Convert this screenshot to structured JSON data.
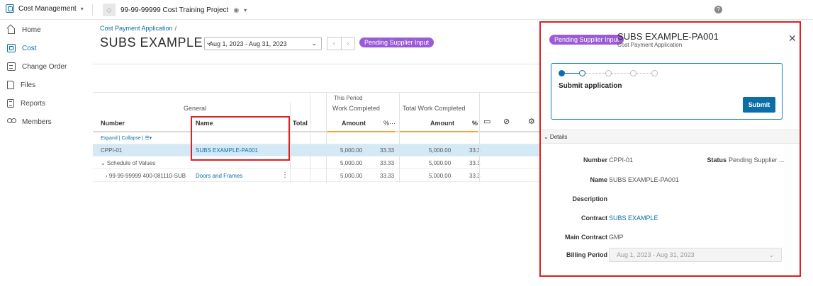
{
  "topbar": {
    "app_name": "Cost Management",
    "project_name": "99-99-99999 Cost Training Project",
    "help_glyph": "?"
  },
  "sidebar": {
    "items": [
      {
        "label": "Home",
        "icon": "home-icon"
      },
      {
        "label": "Cost",
        "icon": "cost-icon",
        "active": true
      },
      {
        "label": "Change Order",
        "icon": "change-order-icon"
      },
      {
        "label": "Files",
        "icon": "file-icon"
      },
      {
        "label": "Reports",
        "icon": "report-icon"
      },
      {
        "label": "Members",
        "icon": "members-icon"
      }
    ]
  },
  "main": {
    "breadcrumb": "Cost Payment Application",
    "breadcrumb_sep": "/",
    "title": "SUBS EXAMPLE",
    "period": "Aug 1, 2023 - Aug 31, 2023",
    "status": "Pending Supplier Input"
  },
  "grid": {
    "group_general": "General",
    "group_this_period": "This Period",
    "sub_work_completed": "Work Completed",
    "sub_total_work_completed": "Total Work Completed",
    "col_number": "Number",
    "col_name": "Name",
    "col_total": "Total",
    "col_amount": "Amount",
    "col_pct": "%",
    "col_pct_more": "%···",
    "toolbar": "Expand | Collapse | ☰▾",
    "rows": [
      {
        "number": "CPPI-01",
        "name": "SUBS EXAMPLE-PA001",
        "amount": "5,000.00",
        "pct": "33.33",
        "total_amount": "5,000.00",
        "total_pct": "33.3"
      },
      {
        "number": "⌄ Schedule of Values",
        "name": "",
        "amount": "5,000.00",
        "pct": "33.33",
        "total_amount": "5,000.00",
        "total_pct": "33.3"
      },
      {
        "number": "› 99-99-99999 400-081110-SUB",
        "name": "Doors and Frames",
        "amount": "5,000.00",
        "pct": "33.33",
        "total_amount": "5,000.00",
        "total_pct": "33.3"
      }
    ]
  },
  "panel": {
    "status": "Pending Supplier Input",
    "title": "SUBS EXAMPLE-PA001",
    "subtitle": "Cost Payment Application",
    "step_label": "Submit application",
    "submit_label": "Submit",
    "details_label": "⌄ Details",
    "fields": {
      "number_label": "Number",
      "number_value": "CPPI-01",
      "status_label": "Status",
      "status_value": "Pending Supplier ...",
      "name_label": "Name",
      "name_value": "SUBS EXAMPLE-PA001",
      "description_label": "Description",
      "contract_label": "Contract",
      "contract_value": "SUBS EXAMPLE",
      "main_contract_label": "Main Contract",
      "main_contract_value": "GMP",
      "billing_period_label": "Billing Period",
      "billing_period_value": "Aug 1, 2023 - Aug 31, 2023"
    }
  },
  "colors": {
    "accent": "#0b6ea8",
    "status_purple": "#9c5bd6",
    "highlight_red": "#e01f1f",
    "selected_row": "#d3e9f6"
  }
}
